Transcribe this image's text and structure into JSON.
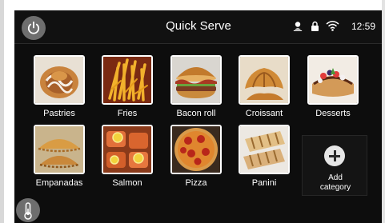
{
  "header": {
    "title": "Quick Serve",
    "clock": "12:59",
    "icons": [
      "power-icon",
      "user-icon",
      "lock-icon",
      "wifi-icon"
    ]
  },
  "categories": [
    {
      "label": "Pastries",
      "icon": "pastries-image"
    },
    {
      "label": "Fries",
      "icon": "fries-image"
    },
    {
      "label": "Bacon roll",
      "icon": "bacon-roll-image"
    },
    {
      "label": "Croissant",
      "icon": "croissant-image"
    },
    {
      "label": "Desserts",
      "icon": "desserts-image"
    },
    {
      "label": "Empanadas",
      "icon": "empanadas-image"
    },
    {
      "label": "Salmon",
      "icon": "salmon-image"
    },
    {
      "label": "Pizza",
      "icon": "pizza-image"
    },
    {
      "label": "Panini",
      "icon": "panini-image"
    }
  ],
  "add_category": {
    "line1": "Add",
    "line2": "category",
    "icon": "plus-icon"
  },
  "footer": {
    "icon": "thermometer-icon"
  },
  "colors": {
    "background": "#0d0d0d",
    "text": "#ffffff",
    "button": "#6e6e6e"
  }
}
